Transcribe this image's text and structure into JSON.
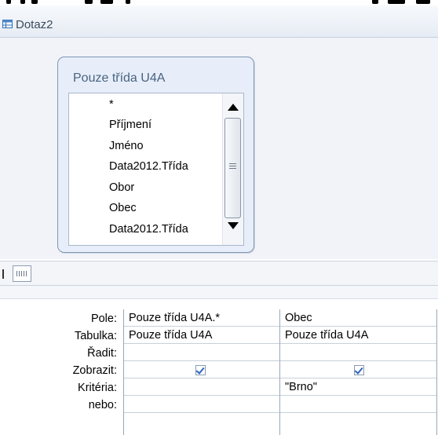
{
  "window": {
    "title": "Dotaz2",
    "icon": "query-datasheet-icon"
  },
  "table": {
    "title": "Pouze třída U4A",
    "fields": [
      "*",
      "Příjmení",
      "Jméno",
      "Data2012.Třída",
      "Obor",
      "Obec",
      "Data2012.Třída"
    ]
  },
  "grid": {
    "row_labels": {
      "pole": "Pole:",
      "tabulka": "Tabulka:",
      "radit": "Řadit:",
      "zobrazit": "Zobrazit:",
      "kriteria": "Kritéria:",
      "nebo": "nebo:"
    },
    "columns": [
      {
        "pole": "Pouze třída U4A.*",
        "tabulka": "Pouze třída U4A",
        "radit": "",
        "zobrazit": true,
        "kriteria": "",
        "nebo": ""
      },
      {
        "pole": "Obec",
        "tabulka": "Pouze třída U4A",
        "radit": "",
        "zobrazit": true,
        "kriteria": "\"Brno\"",
        "nebo": ""
      }
    ]
  }
}
